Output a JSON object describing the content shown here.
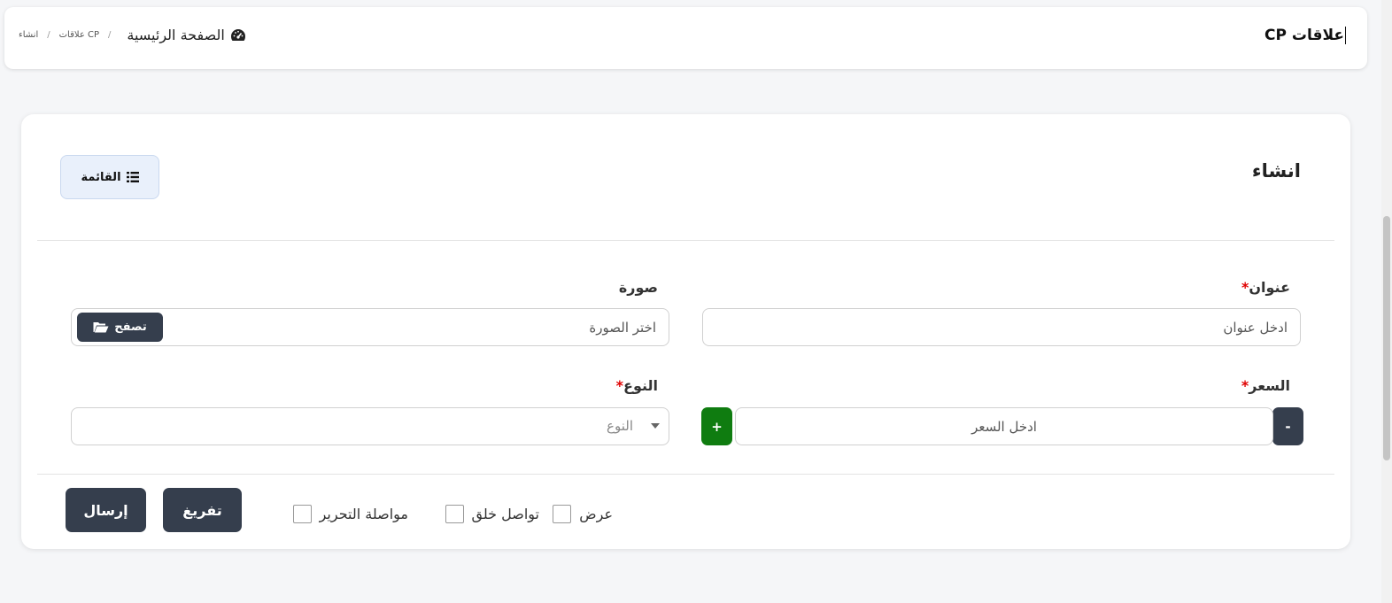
{
  "header": {
    "title": "علاقات CP",
    "breadcrumb": {
      "home": "الصفحة الرئيسية",
      "section": "علاقات CP",
      "current": "انشاء",
      "separator": "/"
    }
  },
  "card": {
    "title": "انشاء",
    "list_button": "القائمة"
  },
  "form": {
    "title_field": {
      "label": "عنوان",
      "required_mark": "*",
      "placeholder": "ادخل عنوان"
    },
    "image_field": {
      "label": "صورة",
      "placeholder": "اختر الصورة",
      "browse_label": "تصفح"
    },
    "price_field": {
      "label": "السعر",
      "required_mark": "*",
      "placeholder": "ادخل السعر",
      "minus": "-",
      "plus": "+"
    },
    "type_field": {
      "label": "النوع",
      "required_mark": "*",
      "placeholder": "النوع"
    }
  },
  "options": {
    "show": "عرض",
    "continue_create": "تواصل خلق",
    "continue_edit": "مواصلة التحرير"
  },
  "actions": {
    "reset": "تفريغ",
    "submit": "إرسال"
  },
  "colors": {
    "primary_dark": "#353e4d",
    "success": "#0f7c10",
    "required": "#e00000",
    "list_button_bg": "#e9f0fb"
  }
}
